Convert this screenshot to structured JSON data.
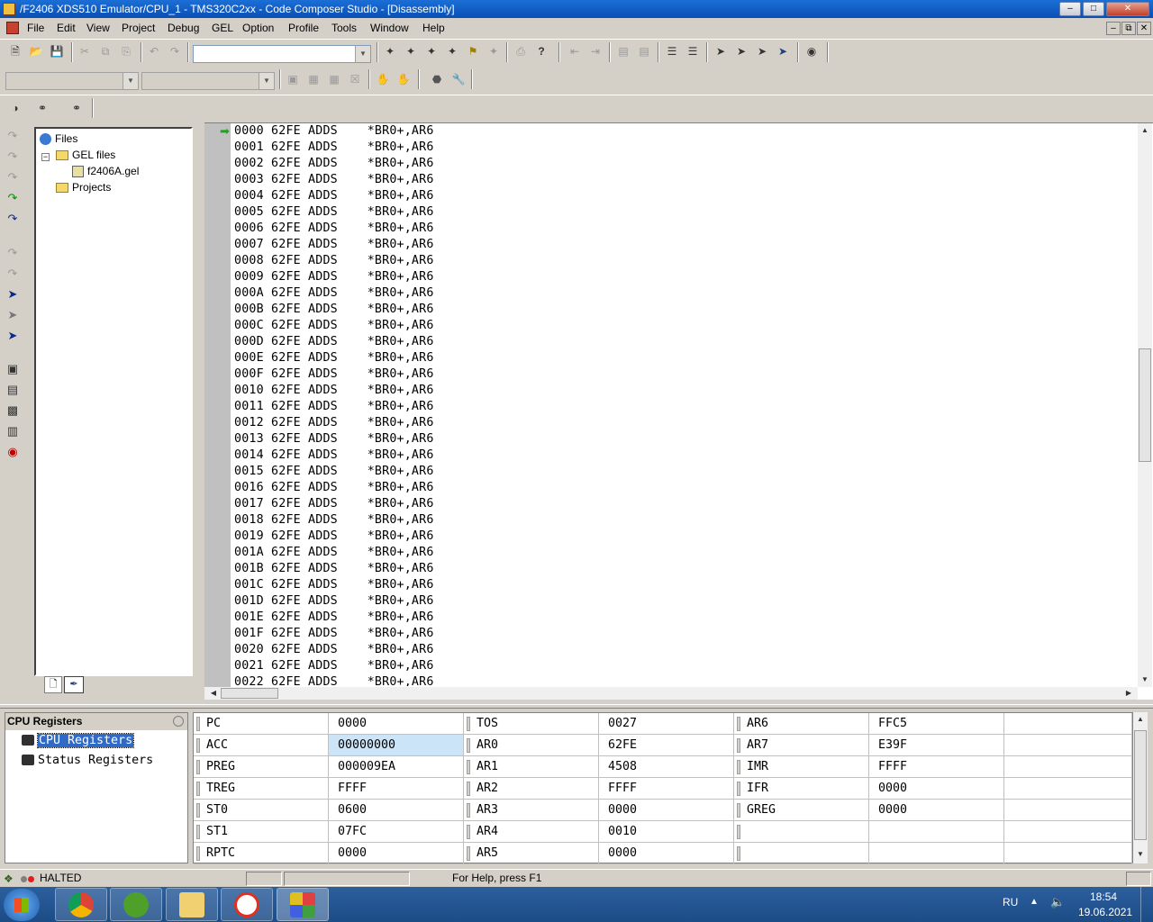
{
  "window": {
    "title": "/F2406 XDS510 Emulator/CPU_1 - TMS320C2xx - Code Composer Studio - [Disassembly]",
    "min_glyph": "–",
    "max_glyph": "□",
    "close_glyph": "✕"
  },
  "menubar": {
    "items": [
      "File",
      "Edit",
      "View",
      "Project",
      "Debug",
      "GEL",
      "Option",
      "Profile",
      "Tools",
      "Window",
      "Help"
    ],
    "mdi_min": "–",
    "mdi_restore": "⧉",
    "mdi_close": "✕"
  },
  "project_tree": {
    "root": "Files",
    "gel_folder": "GEL files",
    "gel_file": "f2406A.gel",
    "projects": "Projects",
    "expander": "−"
  },
  "disassembly": {
    "lines": [
      "0000 62FE ADDS    *BR0+,AR6",
      "0001 62FE ADDS    *BR0+,AR6",
      "0002 62FE ADDS    *BR0+,AR6",
      "0003 62FE ADDS    *BR0+,AR6",
      "0004 62FE ADDS    *BR0+,AR6",
      "0005 62FE ADDS    *BR0+,AR6",
      "0006 62FE ADDS    *BR0+,AR6",
      "0007 62FE ADDS    *BR0+,AR6",
      "0008 62FE ADDS    *BR0+,AR6",
      "0009 62FE ADDS    *BR0+,AR6",
      "000A 62FE ADDS    *BR0+,AR6",
      "000B 62FE ADDS    *BR0+,AR6",
      "000C 62FE ADDS    *BR0+,AR6",
      "000D 62FE ADDS    *BR0+,AR6",
      "000E 62FE ADDS    *BR0+,AR6",
      "000F 62FE ADDS    *BR0+,AR6",
      "0010 62FE ADDS    *BR0+,AR6",
      "0011 62FE ADDS    *BR0+,AR6",
      "0012 62FE ADDS    *BR0+,AR6",
      "0013 62FE ADDS    *BR0+,AR6",
      "0014 62FE ADDS    *BR0+,AR6",
      "0015 62FE ADDS    *BR0+,AR6",
      "0016 62FE ADDS    *BR0+,AR6",
      "0017 62FE ADDS    *BR0+,AR6",
      "0018 62FE ADDS    *BR0+,AR6",
      "0019 62FE ADDS    *BR0+,AR6",
      "001A 62FE ADDS    *BR0+,AR6",
      "001B 62FE ADDS    *BR0+,AR6",
      "001C 62FE ADDS    *BR0+,AR6",
      "001D 62FE ADDS    *BR0+,AR6",
      "001E 62FE ADDS    *BR0+,AR6",
      "001F 62FE ADDS    *BR0+,AR6",
      "0020 62FE ADDS    *BR0+,AR6",
      "0021 62FE ADDS    *BR0+,AR6",
      "0022 62FE ADDS    *BR0+,AR6"
    ],
    "pc_arrow": "➡"
  },
  "registers_panel": {
    "title": "CPU Registers",
    "tree": [
      "CPU Registers",
      "Status Registers"
    ],
    "rows": [
      [
        "PC",
        "0000",
        "TOS",
        "0027",
        "AR6",
        "FFC5"
      ],
      [
        "ACC",
        "00000000",
        "AR0",
        "62FE",
        "AR7",
        "E39F"
      ],
      [
        "PREG",
        "000009EA",
        "AR1",
        "4508",
        "IMR",
        "FFFF"
      ],
      [
        "TREG",
        "FFFF",
        "AR2",
        "FFFF",
        "IFR",
        "0000"
      ],
      [
        "ST0",
        "0600",
        "AR3",
        "0000",
        "GREG",
        "0000"
      ],
      [
        "ST1",
        "07FC",
        "AR4",
        "0010",
        "",
        ""
      ],
      [
        "RPTC",
        "0000",
        "AR5",
        "0000",
        "",
        ""
      ]
    ]
  },
  "statusbar": {
    "state": "HALTED",
    "help": "For Help, press F1"
  },
  "taskbar": {
    "language": "RU",
    "time": "18:54",
    "date": "19.06.2021"
  },
  "colors": {
    "titlebar": "#0a4fb5",
    "selection": "#316ac5",
    "acc_highlight": "#cce4f7",
    "pc_arrow": "#22a022"
  }
}
